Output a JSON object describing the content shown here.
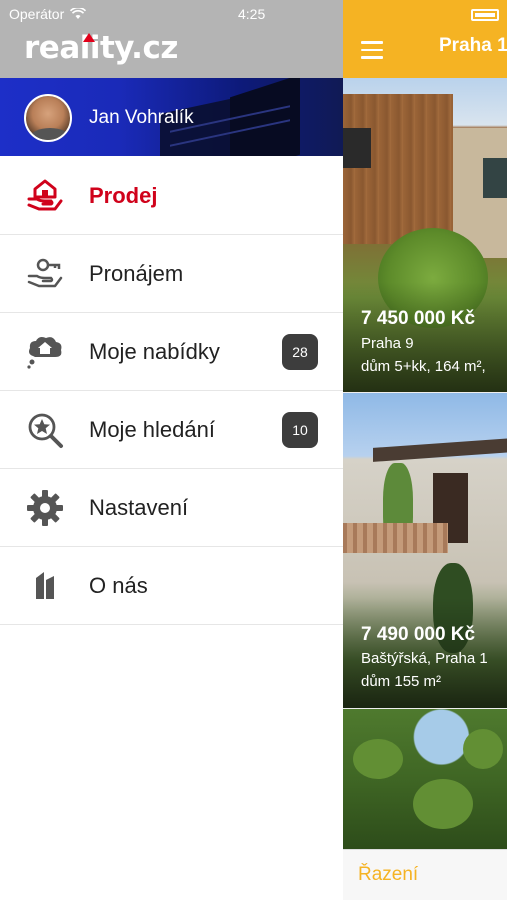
{
  "status_bar": {
    "carrier": "Operátor",
    "time": "4:25"
  },
  "drawer": {
    "logo": "reality.cz",
    "user": {
      "name": "Jan Vohralík"
    },
    "items": [
      {
        "label": "Prodej",
        "icon": "house-in-hand-icon",
        "active": true
      },
      {
        "label": "Pronájem",
        "icon": "key-in-hand-icon",
        "active": false
      },
      {
        "label": "Moje nabídky",
        "icon": "house-thought-cloud-icon",
        "badge": "28"
      },
      {
        "label": "Moje hledání",
        "icon": "star-magnifier-icon",
        "badge": "10"
      },
      {
        "label": "Nastavení",
        "icon": "gear-icon"
      },
      {
        "label": "O nás",
        "icon": "building-icon"
      }
    ]
  },
  "main": {
    "title": "Praha 1",
    "listings": [
      {
        "price": "7 450 000 Kč",
        "location": "Praha 9",
        "description": "dům 5+kk, 164 m²,"
      },
      {
        "price": "7 490 000 Kč",
        "location": "Baštýřská, Praha 1",
        "description": "dům 155 m²"
      }
    ],
    "footer": {
      "sort_label": "Řazení"
    }
  },
  "colors": {
    "accent": "#f5b323",
    "active": "#d0021b",
    "badge": "#3d3d3d"
  }
}
